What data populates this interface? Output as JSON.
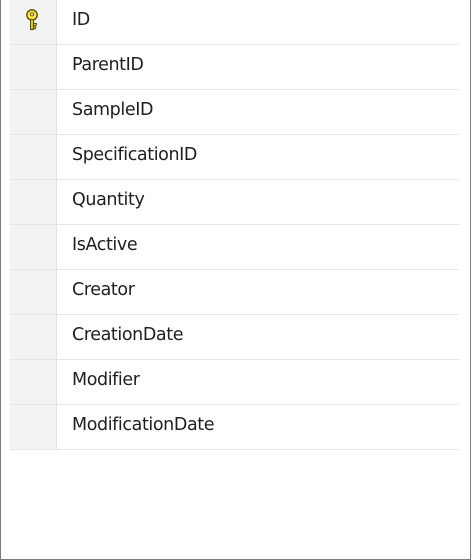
{
  "table": {
    "columns": [
      {
        "name": "ID",
        "primary_key": true,
        "icon": "primary-key-icon"
      },
      {
        "name": "ParentID",
        "primary_key": false
      },
      {
        "name": "SampleID",
        "primary_key": false
      },
      {
        "name": "SpecificationID",
        "primary_key": false
      },
      {
        "name": "Quantity",
        "primary_key": false
      },
      {
        "name": "IsActive",
        "primary_key": false
      },
      {
        "name": "Creator",
        "primary_key": false
      },
      {
        "name": "CreationDate",
        "primary_key": false
      },
      {
        "name": "Modifier",
        "primary_key": false
      },
      {
        "name": "ModificationDate",
        "primary_key": false
      }
    ]
  },
  "colors": {
    "key_fill": "#f5e850",
    "key_outline": "#5a5000",
    "selector_bg": "#f3f3f3",
    "border": "#7a7a7a"
  }
}
